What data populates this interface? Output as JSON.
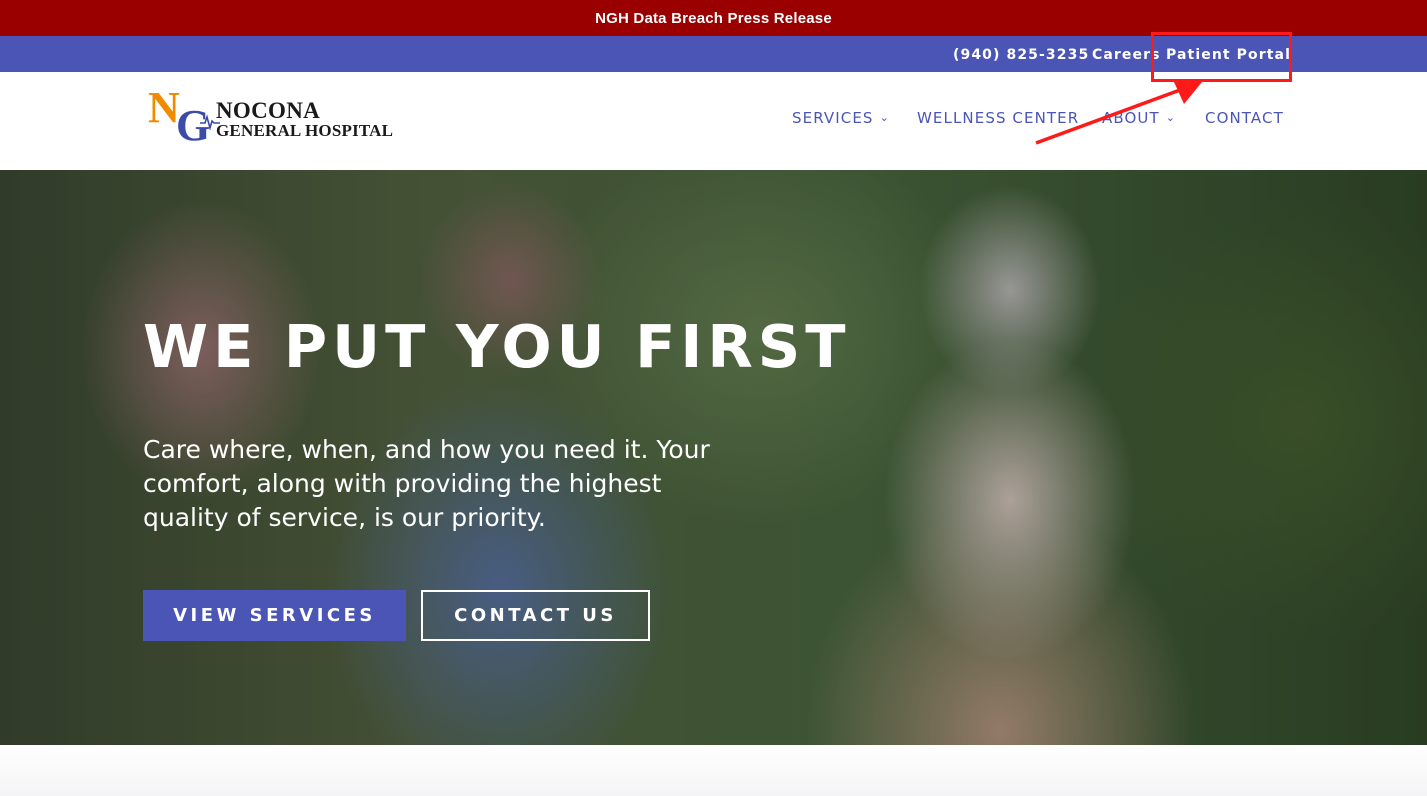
{
  "alert": {
    "text": "NGH Data Breach Press Release"
  },
  "topbar": {
    "phone": "(940) 825-3235",
    "careers": "Careers",
    "patient_portal": "Patient Portal"
  },
  "logo": {
    "mark_n": "N",
    "mark_g": "G",
    "line1": "NOCONA",
    "line2": "GENERAL HOSPITAL"
  },
  "nav": {
    "items": [
      {
        "label": "SERVICES",
        "has_dropdown": true
      },
      {
        "label": "WELLNESS CENTER",
        "has_dropdown": false
      },
      {
        "label": "ABOUT",
        "has_dropdown": true
      },
      {
        "label": "CONTACT",
        "has_dropdown": false
      }
    ],
    "dropdown_glyph": "⌄"
  },
  "hero": {
    "title": "WE PUT YOU FIRST",
    "subtitle": "Care where, when, and how you need it. Your comfort, along with providing the highest quality of service, is our priority.",
    "primary_button": "VIEW SERVICES",
    "secondary_button": "CONTACT US"
  },
  "colors": {
    "alert_bg": "#9b0000",
    "topbar_bg": "#4b55b5",
    "accent": "#4b55b5",
    "logo_orange": "#f08a00",
    "logo_blue": "#3c4aa8",
    "annotation_red": "#ff1a1a"
  }
}
